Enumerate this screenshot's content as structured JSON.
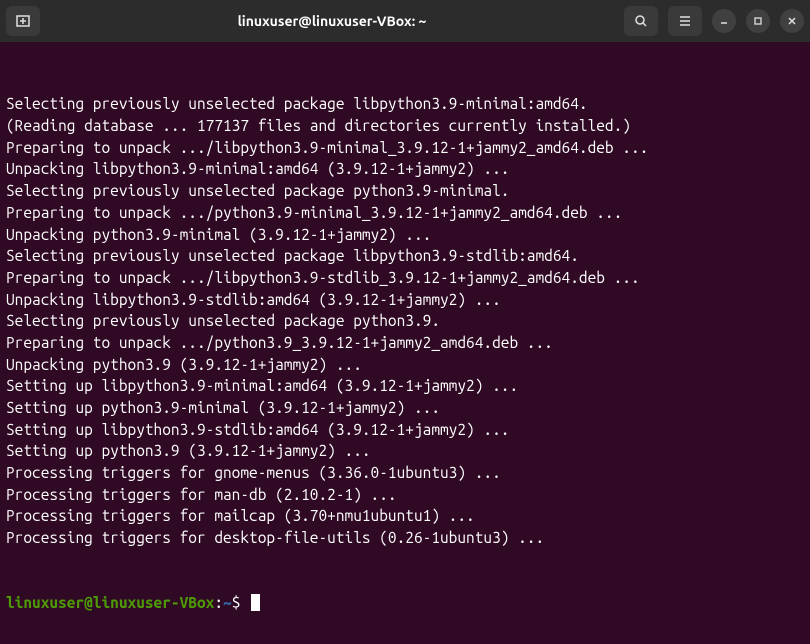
{
  "window": {
    "title": "linuxuser@linuxuser-VBox: ~"
  },
  "terminal": {
    "lines": [
      "Selecting previously unselected package libpython3.9-minimal:amd64.",
      "(Reading database ... 177137 files and directories currently installed.)",
      "Preparing to unpack .../libpython3.9-minimal_3.9.12-1+jammy2_amd64.deb ...",
      "Unpacking libpython3.9-minimal:amd64 (3.9.12-1+jammy2) ...",
      "Selecting previously unselected package python3.9-minimal.",
      "Preparing to unpack .../python3.9-minimal_3.9.12-1+jammy2_amd64.deb ...",
      "Unpacking python3.9-minimal (3.9.12-1+jammy2) ...",
      "Selecting previously unselected package libpython3.9-stdlib:amd64.",
      "Preparing to unpack .../libpython3.9-stdlib_3.9.12-1+jammy2_amd64.deb ...",
      "Unpacking libpython3.9-stdlib:amd64 (3.9.12-1+jammy2) ...",
      "Selecting previously unselected package python3.9.",
      "Preparing to unpack .../python3.9_3.9.12-1+jammy2_amd64.deb ...",
      "Unpacking python3.9 (3.9.12-1+jammy2) ...",
      "Setting up libpython3.9-minimal:amd64 (3.9.12-1+jammy2) ...",
      "Setting up python3.9-minimal (3.9.12-1+jammy2) ...",
      "Setting up libpython3.9-stdlib:amd64 (3.9.12-1+jammy2) ...",
      "Setting up python3.9 (3.9.12-1+jammy2) ...",
      "Processing triggers for gnome-menus (3.36.0-1ubuntu3) ...",
      "Processing triggers for man-db (2.10.2-1) ...",
      "Processing triggers for mailcap (3.70+nmu1ubuntu1) ...",
      "Processing triggers for desktop-file-utils (0.26-1ubuntu3) ..."
    ],
    "prompt": {
      "user_host": "linuxuser@linuxuser-VBox",
      "colon": ":",
      "path": "~",
      "symbol": "$"
    }
  }
}
